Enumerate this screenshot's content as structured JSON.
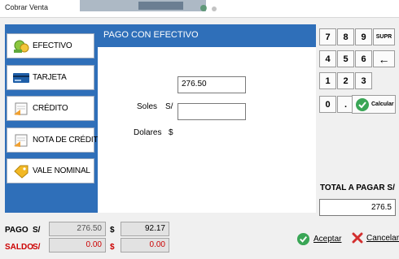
{
  "window": {
    "title": "Cobrar Venta"
  },
  "side_menu": [
    {
      "label": "EFECTIVO",
      "icon": "cash-icon"
    },
    {
      "label": "TARJETA",
      "icon": "card-icon"
    },
    {
      "label": "CRÉDITO",
      "icon": "credit-note-icon"
    },
    {
      "label": "NOTA DE CRÉDITO",
      "icon": "credit-document-icon"
    },
    {
      "label": "VALE NOMINAL",
      "icon": "voucher-tag-icon"
    }
  ],
  "panel": {
    "title": "PAGO CON EFECTIVO"
  },
  "form": {
    "soles_label": "Soles",
    "soles_symbol": "S/",
    "soles_value": "276.50",
    "dolares_label": "Dolares",
    "dolares_symbol": "$",
    "dolares_value": ""
  },
  "keypad": {
    "row1": [
      "7",
      "8",
      "9",
      "SUPR"
    ],
    "row2": [
      "4",
      "5",
      "6",
      "←"
    ],
    "row3": [
      "1",
      "2",
      "3"
    ],
    "row4": [
      "0",
      "."
    ],
    "calc_label": "Calcular"
  },
  "total": {
    "label": "TOTAL A PAGAR S/",
    "value": "276.5"
  },
  "pago": {
    "label": "PAGO",
    "currency1": "S/",
    "value1": "276.50",
    "currency2": "$",
    "value2": "92.17"
  },
  "saldo": {
    "label": "SALDO",
    "currency1": "S/",
    "value1": "0.00",
    "currency2": "$",
    "value2": "0.00"
  },
  "actions": {
    "accept": "Aceptar",
    "cancel": "Cancelar"
  },
  "colors": {
    "panel_blue": "#2f6fb9",
    "saldo_red": "#cc0000",
    "accept_green": "#3aa656",
    "cancel_red": "#d32f2f"
  }
}
